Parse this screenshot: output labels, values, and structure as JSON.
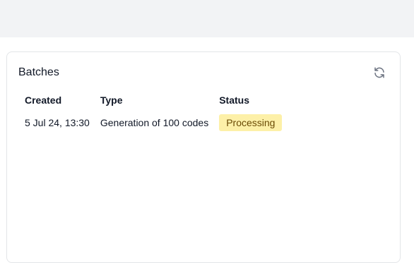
{
  "panel": {
    "title": "Batches",
    "refresh_icon": "refresh-icon"
  },
  "table": {
    "headers": [
      "Created",
      "Type",
      "Status"
    ],
    "rows": [
      {
        "created": "5 Jul 24, 13:30",
        "type": "Generation of 100 codes",
        "status": "Processing"
      }
    ]
  },
  "colors": {
    "top_band": "#f2f3f5",
    "status_processing_bg": "#fdf0a8",
    "status_processing_text": "#6b4b05"
  }
}
